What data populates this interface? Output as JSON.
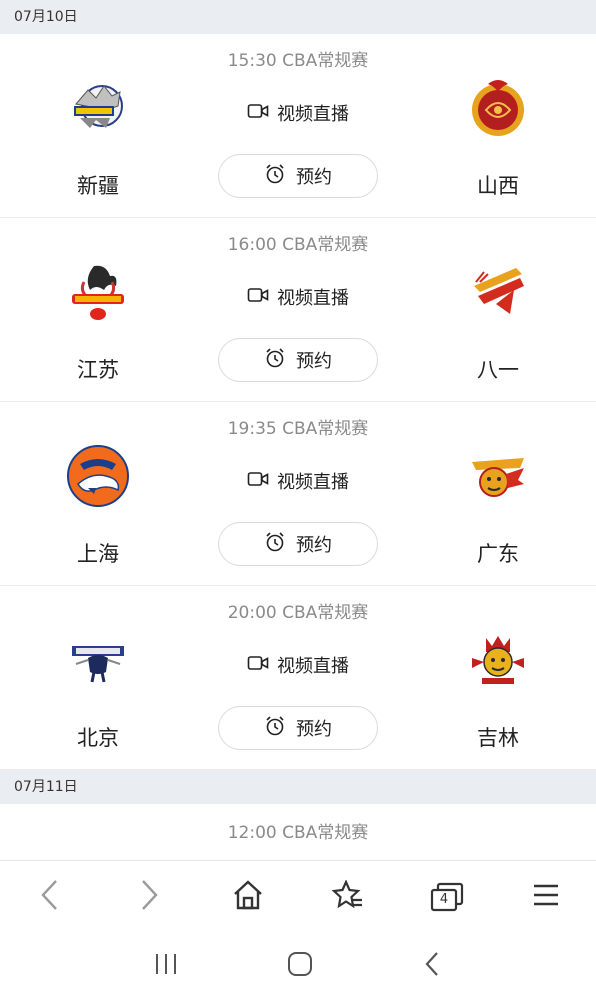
{
  "dates": [
    "07月10日",
    "07月11日"
  ],
  "live_label": "视频直播",
  "reserve_label": "预约",
  "matches": [
    {
      "time": "15:30 CBA常规赛",
      "home": "新疆",
      "away": "山西"
    },
    {
      "time": "16:00 CBA常规赛",
      "home": "江苏",
      "away": "八一"
    },
    {
      "time": "19:35 CBA常规赛",
      "home": "上海",
      "away": "广东"
    },
    {
      "time": "20:00 CBA常规赛",
      "home": "北京",
      "away": "吉林"
    }
  ],
  "next_match": {
    "time": "12:00 CBA常规赛"
  },
  "nav": {
    "tabs_count": "4"
  },
  "icons": {
    "video": "video-camera-icon",
    "alarm": "alarm-clock-icon",
    "back": "chevron-left-icon",
    "forward": "chevron-right-icon",
    "home": "home-icon",
    "favorites": "star-list-icon",
    "tabs": "tabs-icon",
    "menu": "menu-icon"
  },
  "colors": {
    "date_bar_bg": "#eaeef2",
    "time_text": "#8a8a8a"
  }
}
